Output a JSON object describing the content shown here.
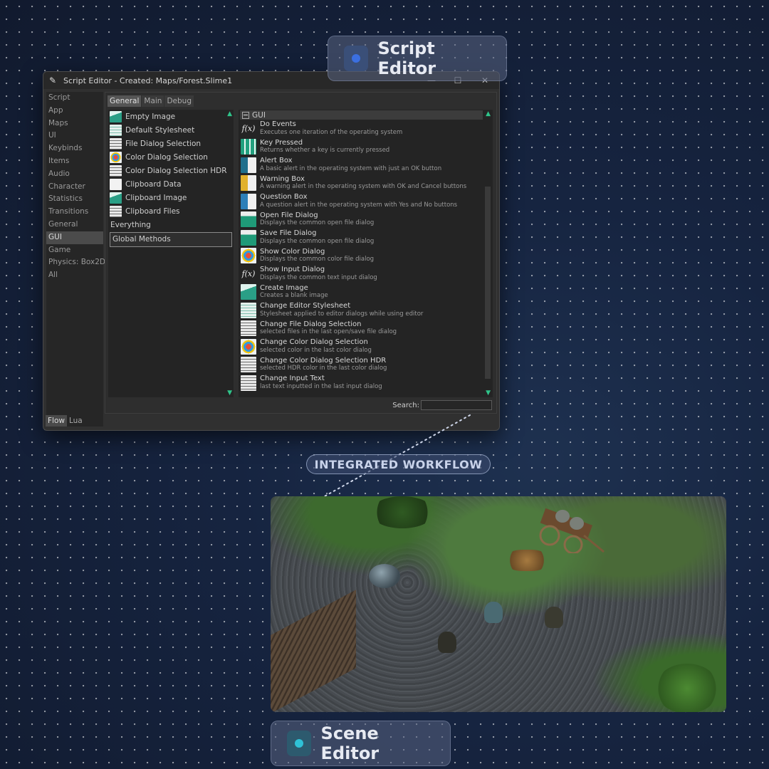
{
  "labels": {
    "script_editor": "Script Editor",
    "scene_editor": "Scene Editor",
    "workflow": "INTEGRATED WORKFLOW"
  },
  "colors": {
    "script_dot": "#3b6fe0",
    "scene_dot": "#2fc1d6",
    "scroll_accent": "#2fc48a"
  },
  "window": {
    "title": "Script Editor - Created: Maps/Forest.Slime1",
    "icon": "feather-icon",
    "controls": [
      "—",
      "☐",
      "✕"
    ]
  },
  "nav": {
    "items": [
      "Script",
      "App",
      "Maps",
      "UI",
      "Keybinds",
      "Items",
      "Audio",
      "Character",
      "Statistics",
      "Transitions",
      "General",
      "GUI",
      "Game",
      "Physics: Box2D",
      "All"
    ],
    "active": "GUI"
  },
  "bottom_tabs": [
    "Flow",
    "Lua"
  ],
  "top_tabs": [
    "General",
    "Main",
    "Debug"
  ],
  "categories": [
    {
      "label": "Empty Image",
      "icon": "image-icon"
    },
    {
      "label": "Default Stylesheet",
      "icon": "stylesheet-icon"
    },
    {
      "label": "File Dialog Selection",
      "icon": "list-icon"
    },
    {
      "label": "Color Dialog Selection",
      "icon": "color-wheel-icon"
    },
    {
      "label": "Color Dialog Selection HDR",
      "icon": "list-icon"
    },
    {
      "label": "Clipboard Data",
      "icon": "document-icon"
    },
    {
      "label": "Clipboard Image",
      "icon": "image-icon"
    },
    {
      "label": "Clipboard Files",
      "icon": "list-icon"
    }
  ],
  "extra_categories": {
    "everything": "Everything",
    "global_methods": "Global Methods"
  },
  "methods_header": "GUI",
  "methods": [
    {
      "title": "Do Events",
      "desc": "Executes one iteration of the operating system",
      "icon": "function-icon"
    },
    {
      "title": "Key Pressed",
      "desc": "Returns whether a key is currently pressed",
      "icon": "keyboard-icon"
    },
    {
      "title": "Alert Box",
      "desc": "A basic alert in the operating system with just an OK button",
      "icon": "alert-icon"
    },
    {
      "title": "Warning Box",
      "desc": "A warning alert in the operating system with OK and Cancel buttons",
      "icon": "warning-icon"
    },
    {
      "title": "Question Box",
      "desc": "A question alert in the operating system with Yes and No buttons",
      "icon": "question-icon"
    },
    {
      "title": "Open File Dialog",
      "desc": "Displays the common open file dialog",
      "icon": "folder-icon"
    },
    {
      "title": "Save File Dialog",
      "desc": "Displays the common open file dialog",
      "icon": "folder-icon"
    },
    {
      "title": "Show Color Dialog",
      "desc": "Displays the common color file dialog",
      "icon": "color-wheel-icon"
    },
    {
      "title": "Show Input Dialog",
      "desc": "Displays the common text input dialog",
      "icon": "function-icon"
    },
    {
      "title": "Create Image",
      "desc": "Creates a blank image",
      "icon": "image-icon"
    },
    {
      "title": "Change Editor Stylesheet",
      "desc": "Stylesheet applied to editor dialogs while using editor",
      "icon": "stylesheet-icon"
    },
    {
      "title": "Change File Dialog Selection",
      "desc": "selected files in the last open/save file dialog",
      "icon": "list-icon"
    },
    {
      "title": "Change Color Dialog Selection",
      "desc": "selected color in the last color dialog",
      "icon": "color-wheel-icon"
    },
    {
      "title": "Change Color Dialog Selection HDR",
      "desc": "selected HDR color in the last color dialog",
      "icon": "list-icon"
    },
    {
      "title": "Change Input Text",
      "desc": "last text inputted in the last input dialog",
      "icon": "list-icon"
    }
  ],
  "search": {
    "label": "Search:",
    "value": ""
  }
}
